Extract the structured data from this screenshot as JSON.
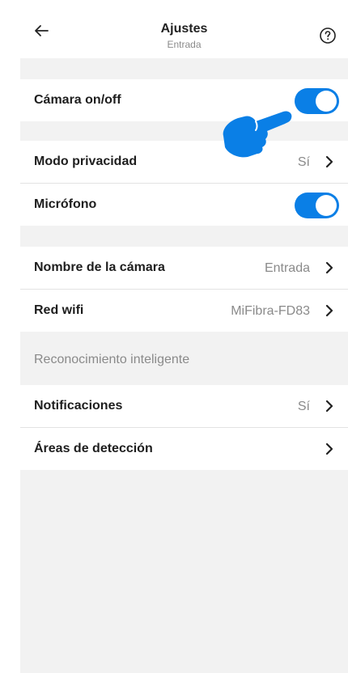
{
  "header": {
    "title": "Ajustes",
    "subtitle": "Entrada"
  },
  "group1": {
    "camera": {
      "label": "Cámara on/off",
      "toggle_on": true
    }
  },
  "group2": {
    "privacy": {
      "label": "Modo privacidad",
      "value": "Sí"
    },
    "microphone": {
      "label": "Micrófono",
      "toggle_on": true
    }
  },
  "group3": {
    "camera_name": {
      "label": "Nombre de la cámara",
      "value": "Entrada"
    },
    "wifi": {
      "label": "Red wifi",
      "value": "MiFibra-FD83"
    }
  },
  "smart_section": {
    "title": "Reconocimiento inteligente",
    "notifications": {
      "label": "Notificaciones",
      "value": "Sí"
    },
    "detection_areas": {
      "label": "Áreas de detección"
    }
  },
  "colors": {
    "accent": "#0a7fe6",
    "background": "#f2f2f2"
  },
  "icons": {
    "back": "arrow-left-icon",
    "help": "question-circle-icon",
    "chevron": "chevron-right-icon",
    "pointer": "hand-pointer-icon"
  }
}
